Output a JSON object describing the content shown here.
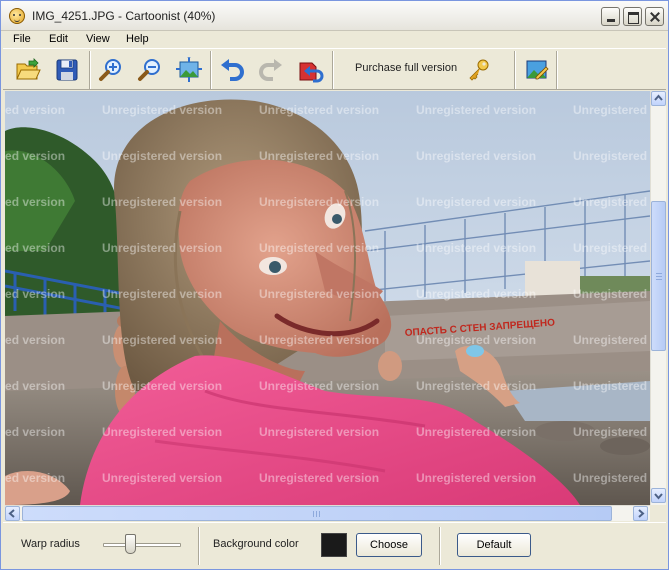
{
  "window": {
    "title": "IMG_4251.JPG - Cartoonist (40%)",
    "app_icon": "cartoon-face-icon"
  },
  "menu": [
    {
      "label": "File"
    },
    {
      "label": "Edit"
    },
    {
      "label": "View"
    },
    {
      "label": "Help"
    }
  ],
  "toolbar": {
    "buttons": [
      {
        "name": "open-folder-icon"
      },
      {
        "name": "save-disk-icon"
      },
      {
        "name": "zoom-in-icon"
      },
      {
        "name": "zoom-out-icon"
      },
      {
        "name": "fit-to-window-icon"
      },
      {
        "name": "undo-icon"
      },
      {
        "name": "redo-icon"
      },
      {
        "name": "reset-icon"
      },
      {
        "name": "image-edit-icon"
      }
    ],
    "purchase_label": "Purchase full version",
    "purchase_icon": "key-icon"
  },
  "watermark_text": "Unregistered version",
  "photo_caption": "ОПАСТЬ С СТЕН ЗАПРЕЩЕНО",
  "bottom": {
    "warp_radius_label": "Warp radius",
    "warp_radius_level": 0.33,
    "background_color_label": "Background color",
    "background_color": "#1a1a1a",
    "choose_label": "Choose",
    "default_label": "Default"
  },
  "colors": {
    "accent": "#3b5a8a",
    "scrollbar": "#c1d3fb",
    "shirt": "#ec4f8a"
  }
}
